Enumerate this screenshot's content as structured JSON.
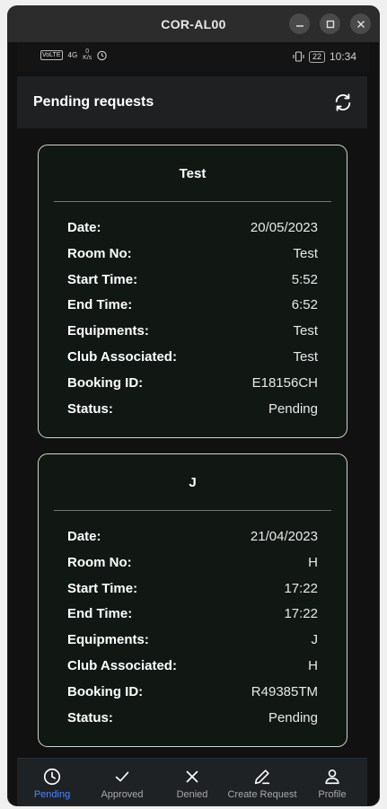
{
  "window": {
    "title": "COR-AL00"
  },
  "statusbar": {
    "network_badge": "VoLTE",
    "signal_text": "4G",
    "speed_value": "0",
    "speed_unit": "K/s",
    "battery": "22",
    "time": "10:34"
  },
  "appbar": {
    "title": "Pending requests"
  },
  "labels": {
    "date": "Date:",
    "room": "Room No:",
    "start": "Start Time:",
    "end": "End Time:",
    "equip": "Equipments:",
    "club": "Club Associated:",
    "booking": "Booking ID:",
    "status": "Status:"
  },
  "cards": [
    {
      "title": "Test",
      "date": "20/05/2023",
      "room": "Test",
      "start": "5:52",
      "end": "6:52",
      "equip": "Test",
      "club": "Test",
      "booking": "E18156CH",
      "status": "Pending"
    },
    {
      "title": "J",
      "date": "21/04/2023",
      "room": "H",
      "start": "17:22",
      "end": "17:22",
      "equip": "J",
      "club": "H",
      "booking": "R49385TM",
      "status": "Pending"
    }
  ],
  "nav": [
    {
      "label": "Pending",
      "icon": "clock-icon",
      "active": true
    },
    {
      "label": "Approved",
      "icon": "check-icon",
      "active": false
    },
    {
      "label": "Denied",
      "icon": "close-icon",
      "active": false
    },
    {
      "label": "Create Request",
      "icon": "pencil-icon",
      "active": false
    },
    {
      "label": "Profile",
      "icon": "person-icon",
      "active": false
    }
  ],
  "colors": {
    "accent": "#4a86ff",
    "background": "#111111",
    "card_border": "#cfd4d0"
  }
}
